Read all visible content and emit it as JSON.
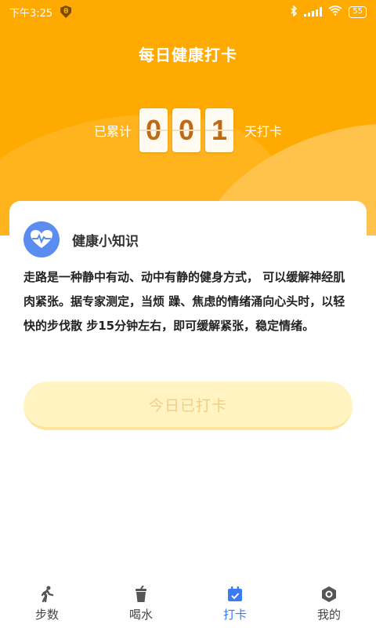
{
  "status_bar": {
    "time": "下午3:25",
    "shield_glyph": "θ",
    "battery": "55"
  },
  "header": {
    "title": "每日健康打卡",
    "counter_prefix": "已累计",
    "counter_digits": [
      "0",
      "0",
      "1"
    ],
    "counter_suffix": "天打卡"
  },
  "tip": {
    "title": "健康小知识",
    "body": "走路是一种静中有动、动中有静的健身方式， 可以缓解神经肌肉紧张。据专家测定，当烦 躁、焦虑的情绪涌向心头时，以轻快的步伐散 步15分钟左右，即可缓解紧张，稳定情绪。"
  },
  "checkin_button": {
    "label": "今日已打卡"
  },
  "tabs": [
    {
      "label": "步数",
      "icon": "walking-icon",
      "active": false
    },
    {
      "label": "喝水",
      "icon": "cup-icon",
      "active": false
    },
    {
      "label": "打卡",
      "icon": "calendar-check-icon",
      "active": true
    },
    {
      "label": "我的",
      "icon": "profile-hexagon-icon",
      "active": false
    }
  ],
  "colors": {
    "header_bg": "#FFAA00",
    "accent_active": "#3A7AF2",
    "digit_text": "#C06A12"
  }
}
